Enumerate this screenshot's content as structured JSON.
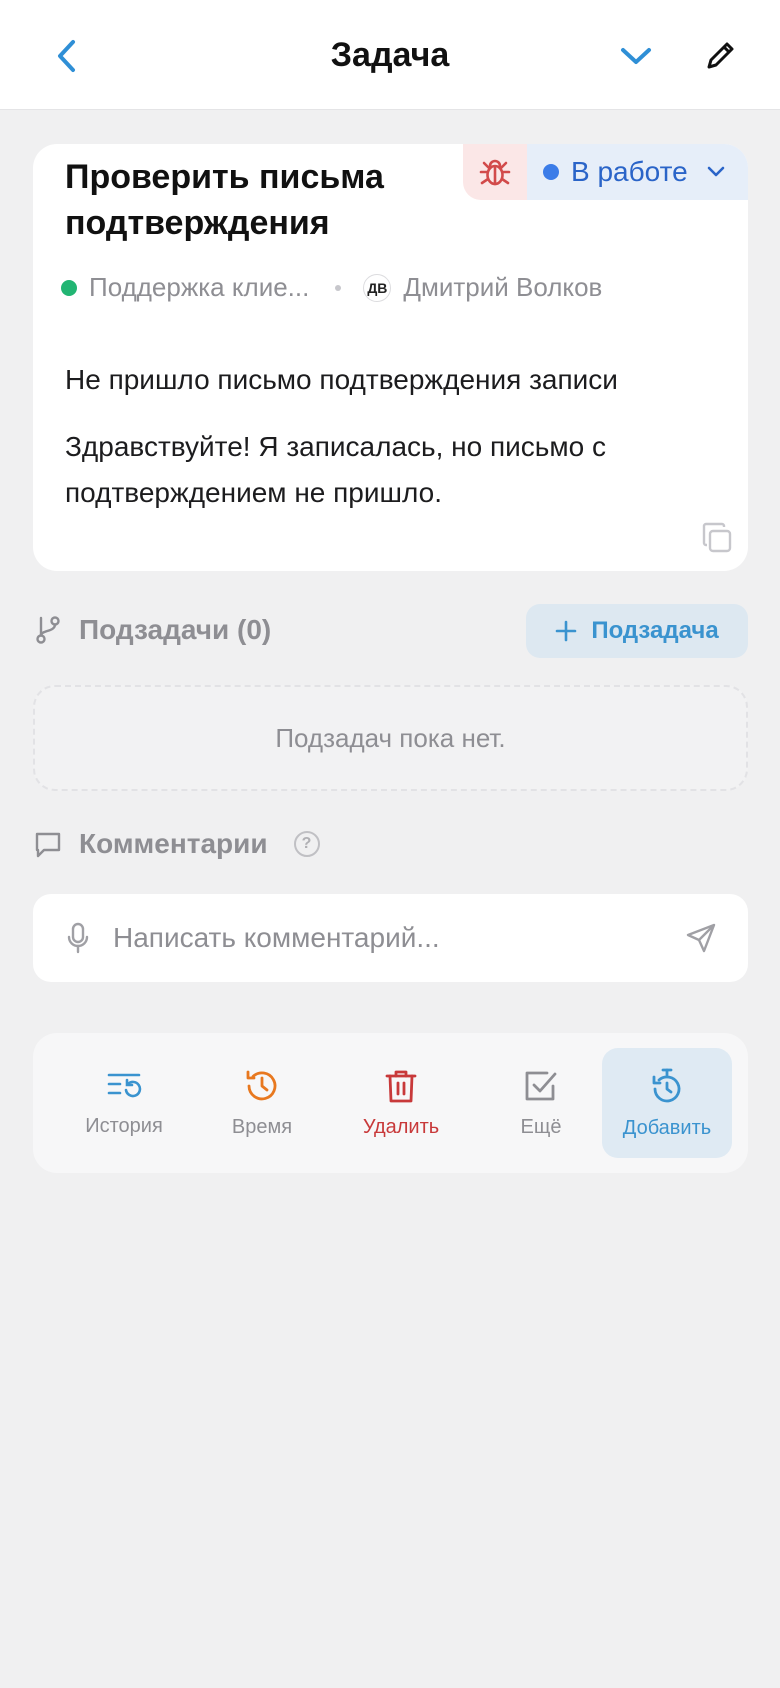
{
  "header": {
    "title": "Задача"
  },
  "task": {
    "title": "Проверить письма подтверждения",
    "status": "В работе",
    "project": "Поддержка клие...",
    "assignee_initials": "ДВ",
    "assignee": "Дмитрий Волков",
    "subject": "Не пришло письмо подтверждения записи",
    "body": "Здравствуйте! Я записалась, но письмо с подтверждением не пришло."
  },
  "subtasks": {
    "heading": "Подзадачи (0)",
    "add_label": "Подзадача",
    "empty_text": "Подзадач пока нет."
  },
  "comments": {
    "heading": "Комментарии",
    "help": "?",
    "placeholder": "Написать комментарий..."
  },
  "actions": [
    {
      "label": "История"
    },
    {
      "label": "Время"
    },
    {
      "label": "Удалить"
    },
    {
      "label": "Ещё"
    },
    {
      "label": "Добавить"
    }
  ],
  "colors": {
    "accent": "#3a93cf",
    "status": "#3b7ce8",
    "danger": "#c8393a",
    "time": "#e8781f",
    "project_dot": "#22b573"
  }
}
